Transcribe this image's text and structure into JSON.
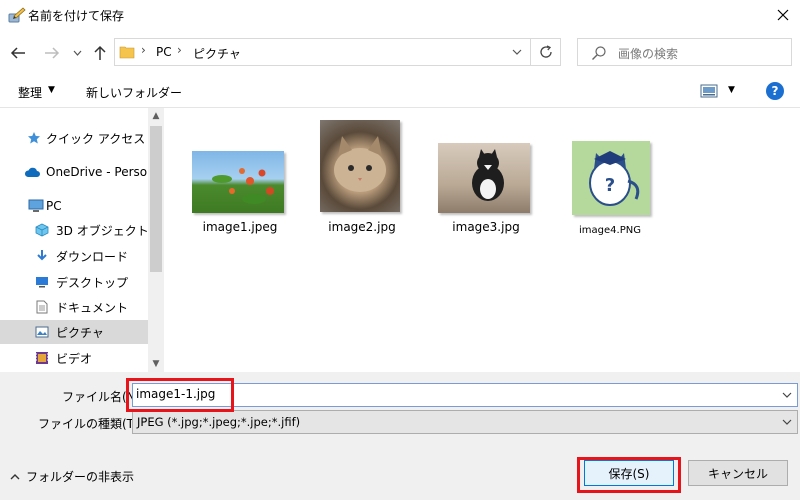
{
  "window": {
    "title": "名前を付けて保存"
  },
  "address": {
    "segments": [
      "PC",
      "ピクチャ"
    ],
    "separator": "›"
  },
  "search": {
    "placeholder": "画像の検索"
  },
  "toolbar": {
    "organize": "整理",
    "new_folder": "新しいフォルダー"
  },
  "help": {
    "label": "?"
  },
  "nav": {
    "items": [
      {
        "label": "クイック アクセス",
        "icon": "star-icon"
      },
      {
        "label": "OneDrive - Person",
        "icon": "cloud-icon"
      },
      {
        "label": "PC",
        "icon": "computer-icon"
      },
      {
        "label": "3D オブジェクト",
        "icon": "cube-icon"
      },
      {
        "label": "ダウンロード",
        "icon": "download-icon"
      },
      {
        "label": "デスクトップ",
        "icon": "desktop-icon"
      },
      {
        "label": "ドキュメント",
        "icon": "document-icon"
      },
      {
        "label": "ピクチャ",
        "icon": "pictures-icon",
        "selected": true
      },
      {
        "label": "ビデオ",
        "icon": "video-icon"
      }
    ]
  },
  "files": [
    {
      "name": "image1.jpeg"
    },
    {
      "name": "image2.jpg"
    },
    {
      "name": "image3.jpg"
    },
    {
      "name": "image4.PNG"
    }
  ],
  "form": {
    "filename_label": "ファイル名(N):",
    "filename_value": "image1-1.jpg",
    "filetype_label": "ファイルの種類(T):",
    "filetype_value": "JPEG (*.jpg;*.jpeg;*.jpe;*.jfif)"
  },
  "footer": {
    "hide_folders": "フォルダーの非表示",
    "save": "保存(S)",
    "cancel": "キャンセル"
  },
  "colors": {
    "highlight": "#e8141b",
    "accent": "#0078d7",
    "selected_bg": "#d9d9d9"
  }
}
